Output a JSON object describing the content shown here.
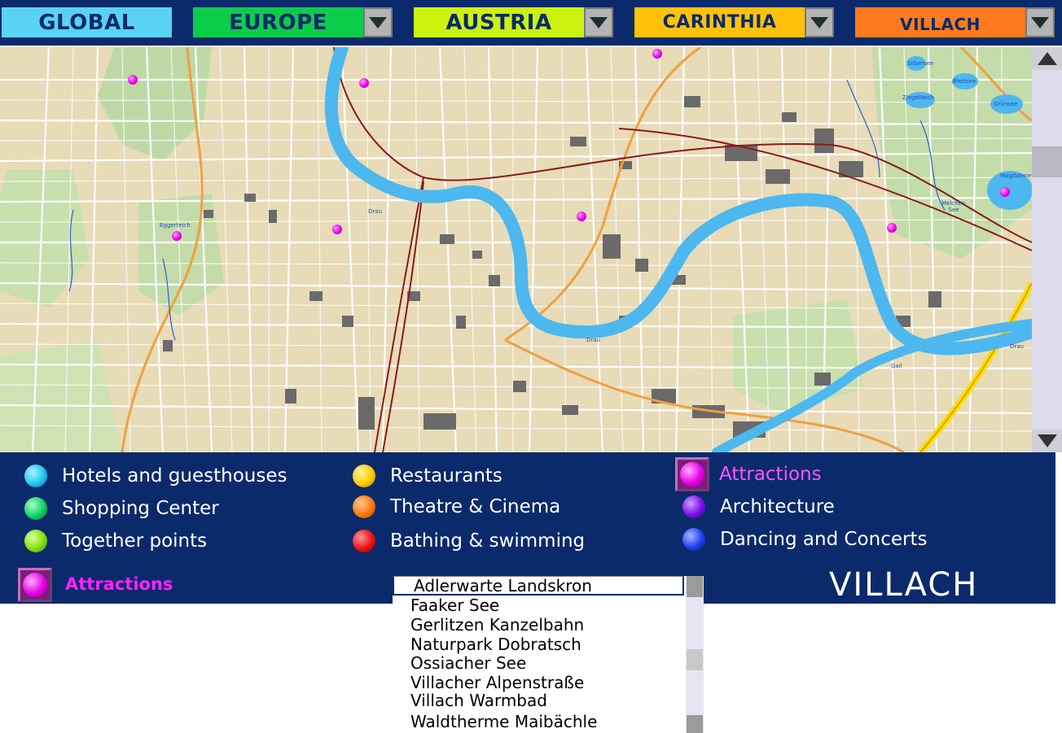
{
  "nav": {
    "global": {
      "label": "GLOBAL",
      "color": "#5ad2f5"
    },
    "europe": {
      "label": "EUROPE",
      "color": "#0ccd4a"
    },
    "austria": {
      "label": "AUSTRIA",
      "color": "#ccf20f"
    },
    "carinthia": {
      "label": "CARINTHIA",
      "color": "#ffc20b"
    },
    "villach": {
      "label": "VILLACH",
      "color": "#ff7a1e"
    }
  },
  "map": {
    "labels": [
      "Eggerteich",
      "Drau",
      "Drau",
      "Drau",
      "Gail",
      "Magdalenen",
      "Melcher-See",
      "Ziegelteich",
      "Silbersee",
      "Grünsee",
      "Bleitsee"
    ]
  },
  "legend": {
    "col1": [
      {
        "label": "Hotels and guesthouses",
        "color": "#1fc8f0"
      },
      {
        "label": "Shopping Center",
        "color": "#0ed060"
      },
      {
        "label": "Together points",
        "color": "#7ee00f"
      }
    ],
    "col2": [
      {
        "label": "Restaurants",
        "color": "#ffcc00"
      },
      {
        "label": "Theatre & Cinema",
        "color": "#ff7a0b"
      },
      {
        "label": "Bathing & swimming",
        "color": "#f01010"
      }
    ],
    "col3": [
      {
        "label": "Attractions",
        "color": "#e800e8",
        "selected": true,
        "text_color": "#ff55ff"
      },
      {
        "label": "Architecture",
        "color": "#7a10e8"
      },
      {
        "label": "Dancing and Concerts",
        "color": "#2040f0"
      }
    ]
  },
  "category": {
    "label": "Attractions"
  },
  "city": {
    "title": "VILLACH"
  },
  "attractions": {
    "items": [
      "Adlerwarte Landskron",
      "Faaker See",
      "Gerlitzen Kanzelbahn",
      "Naturpark Dobratsch",
      "Ossiacher See",
      "Villacher Alpenstraße",
      "Villach Warmbad",
      "Waldtherme Maibächle"
    ],
    "selected": "Adlerwarte Landskron"
  }
}
